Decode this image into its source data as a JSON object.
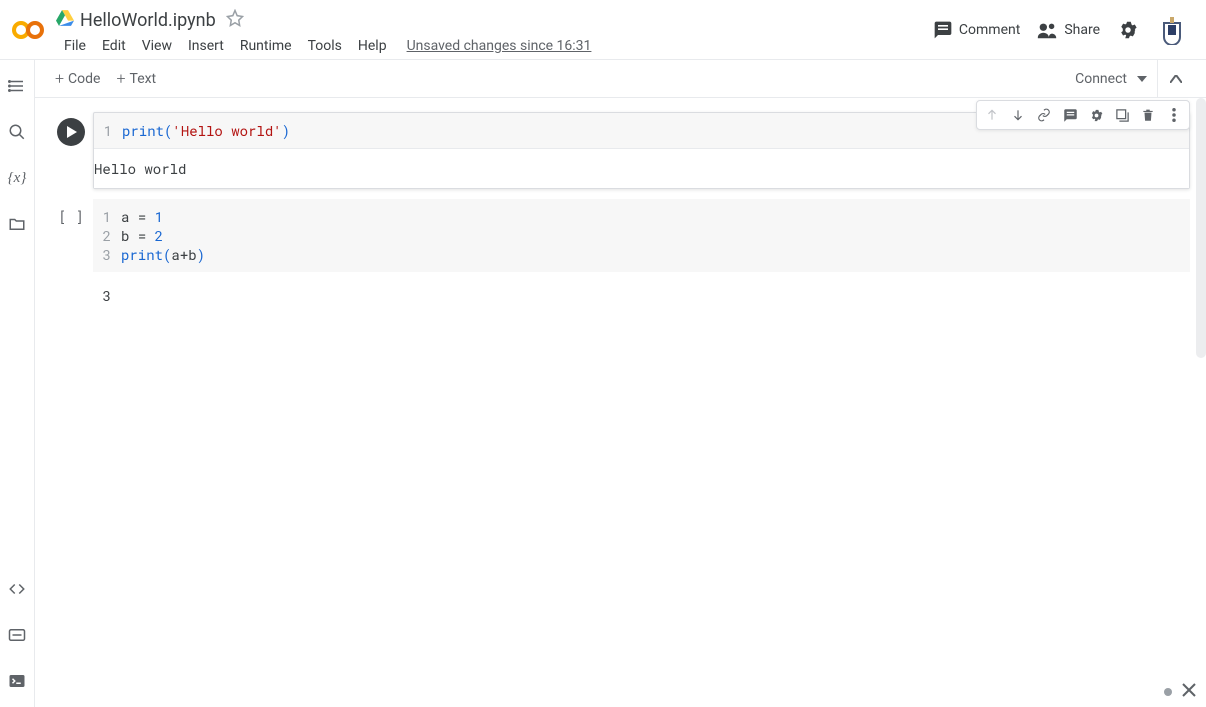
{
  "header": {
    "notebook_title": "HelloWorld.ipynb",
    "menu": [
      "File",
      "Edit",
      "View",
      "Insert",
      "Runtime",
      "Tools",
      "Help"
    ],
    "unsaved": "Unsaved changes since 16:31",
    "comment": "Comment",
    "share": "Share"
  },
  "toolbar": {
    "code": "Code",
    "text": "Text",
    "connect": "Connect"
  },
  "cells": [
    {
      "focused": true,
      "lines": [
        {
          "n": "1",
          "tokens": [
            [
              "kw",
              "print"
            ],
            [
              "paren",
              "("
            ],
            [
              "str",
              "'Hello world'"
            ],
            [
              "paren",
              ")"
            ]
          ]
        }
      ],
      "output": "Hello world"
    },
    {
      "focused": false,
      "lines": [
        {
          "n": "1",
          "tokens": [
            [
              "",
              "a "
            ],
            [
              "",
              "= "
            ],
            [
              "num",
              "1"
            ]
          ]
        },
        {
          "n": "2",
          "tokens": [
            [
              "",
              "b "
            ],
            [
              "",
              "= "
            ],
            [
              "num",
              "2"
            ]
          ]
        },
        {
          "n": "3",
          "tokens": [
            [
              "kw",
              "print"
            ],
            [
              "paren",
              "("
            ],
            [
              "",
              "a"
            ],
            [
              "",
              "+"
            ],
            [
              "",
              "b"
            ],
            [
              "paren",
              ")"
            ]
          ]
        }
      ],
      "output": "3"
    }
  ],
  "cell_toolbar_icons": [
    "arrow-up",
    "arrow-down",
    "link",
    "comment",
    "settings",
    "mirror",
    "delete",
    "more"
  ]
}
